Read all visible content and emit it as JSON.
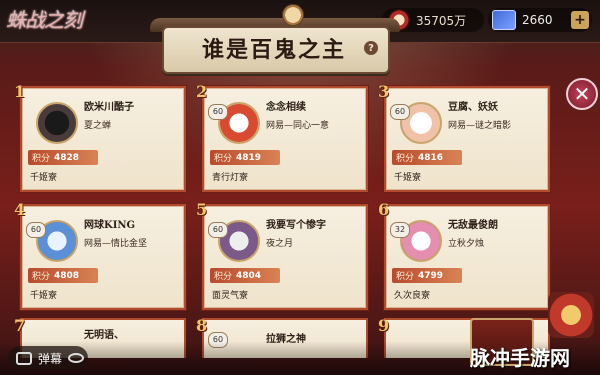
{
  "header": {
    "logo_text": "蛛战之刻",
    "coins": "35705万",
    "jade": "2660",
    "plus": "+"
  },
  "title": {
    "text": "谁是百鬼之主",
    "help": "?"
  },
  "close": "✕",
  "score_label": "积分",
  "players": [
    {
      "rank": "1",
      "level": "",
      "name": "欧米川酷子",
      "guild": "夏之蝉",
      "score": "4828",
      "region": "千姬寮"
    },
    {
      "rank": "2",
      "level": "60",
      "name": "念念相续",
      "guild": "网易—同心一意",
      "score": "4819",
      "region": "青行灯寮"
    },
    {
      "rank": "3",
      "level": "60",
      "name": "豆腐、妖妖",
      "guild": "网易—谜之暗影",
      "score": "4816",
      "region": "千姬寮"
    },
    {
      "rank": "4",
      "level": "60",
      "name": "网球KING",
      "guild": "网易—情比金坚",
      "score": "4808",
      "region": "千姬寮"
    },
    {
      "rank": "5",
      "level": "60",
      "name": "我要写个惨字",
      "guild": "夜之月",
      "score": "4804",
      "region": "面灵气寮"
    },
    {
      "rank": "6",
      "level": "32",
      "name": "无敌最俊朗",
      "guild": "立秋夕烛",
      "score": "4799",
      "region": "久次良寮"
    }
  ],
  "partial_row": [
    {
      "rank": "7",
      "name": "无明语、"
    },
    {
      "rank": "8",
      "level": "60",
      "name": "拉狮之神"
    },
    {
      "rank": "9",
      "level": ""
    }
  ],
  "danmaku": {
    "label": "弹幕"
  },
  "watermark": "脉冲手游网"
}
